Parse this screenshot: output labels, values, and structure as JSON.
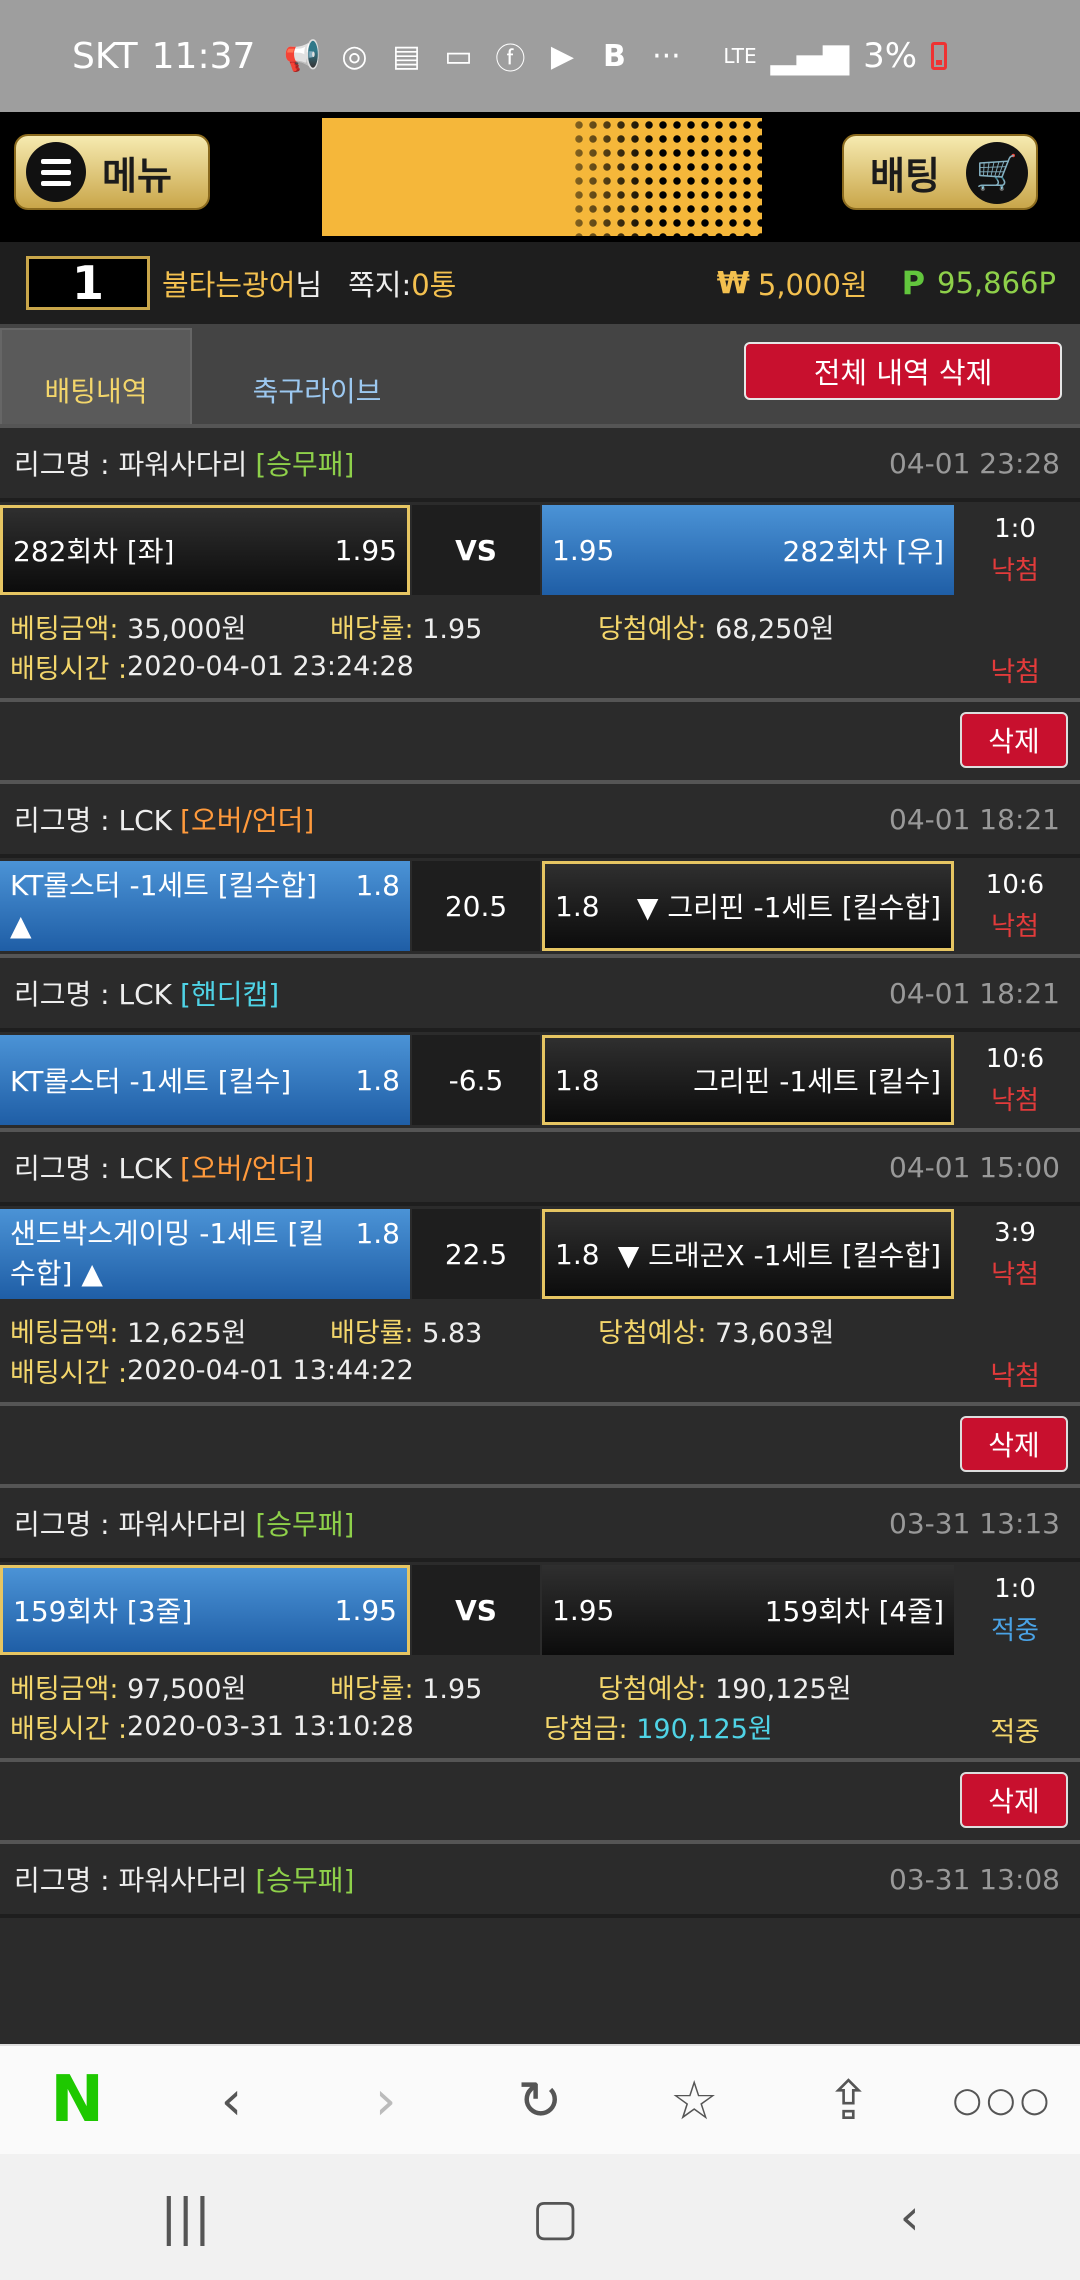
{
  "status": {
    "carrier": "SKT",
    "time": "11:37",
    "battery": "3%",
    "net": "LTE"
  },
  "header": {
    "menu_label": "메뉴",
    "bet_label": "배팅"
  },
  "user": {
    "level": "1",
    "name": "불타는광어",
    "suffix": "님",
    "message_label": "쪽지:",
    "message_count": "0통",
    "cash_icon": "₩",
    "cash": "5,000원",
    "points_icon": "P",
    "points": "95,866P"
  },
  "tabs": {
    "active": "배팅내역",
    "inactive": "축구라이브",
    "delete_all": "전체 내역 삭제"
  },
  "labels": {
    "league_prefix": "리그명 : ",
    "bet_amount": "베팅금액:",
    "odds": "배당률:",
    "expected": "당첨예상:",
    "bet_time": "배팅시간 : ",
    "win_amount": "당첨금:",
    "delete": "삭제"
  },
  "bets": [
    {
      "games": [
        {
          "league": "파워사다리",
          "type": "[승무패]",
          "date": "04-01 23:28",
          "left_name": "282회차 [좌]",
          "left_odds": "1.95",
          "mid": "VS",
          "right_odds": "1.95",
          "right_name": "282회차 [우]",
          "score": "1:0",
          "result": "낙첨"
        }
      ],
      "amount": "35,000원",
      "odds": "1.95",
      "expected": "68,250원",
      "time": "2020-04-01 23:24:28",
      "status": "낙첨"
    },
    {
      "games": [
        {
          "league": "LCK",
          "type": "[오버/언더]",
          "date": "04-01 18:21",
          "left_name": "KT롤스터 -1세트 [킬수합] ▲",
          "left_odds": "1.8",
          "mid": "20.5",
          "right_odds": "1.8",
          "right_name": "▼ 그리핀 -1세트 [킬수합]",
          "score": "10:6",
          "result": "낙첨"
        },
        {
          "league": "LCK",
          "type": "[핸디캡]",
          "date": "04-01 18:21",
          "left_name": "KT롤스터 -1세트 [킬수]",
          "left_odds": "1.8",
          "mid": "-6.5",
          "right_odds": "1.8",
          "right_name": "그리핀 -1세트 [킬수]",
          "score": "10:6",
          "result": "낙첨"
        },
        {
          "league": "LCK",
          "type": "[오버/언더]",
          "date": "04-01 15:00",
          "left_name": "샌드박스게이밍 -1세트 [킬수합] ▲",
          "left_odds": "1.8",
          "mid": "22.5",
          "right_odds": "1.8",
          "right_name": "▼ 드래곤X -1세트 [킬수합]",
          "score": "3:9",
          "result": "낙첨"
        }
      ],
      "amount": "12,625원",
      "odds": "5.83",
      "expected": "73,603원",
      "time": "2020-04-01 13:44:22",
      "status": "낙첨"
    },
    {
      "games": [
        {
          "league": "파워사다리",
          "type": "[승무패]",
          "date": "03-31 13:13",
          "left_name": "159회차 [3줄]",
          "left_odds": "1.95",
          "mid": "VS",
          "right_odds": "1.95",
          "right_name": "159회차 [4줄]",
          "score": "1:0",
          "result": "적중"
        }
      ],
      "amount": "97,500원",
      "odds": "1.95",
      "expected": "190,125원",
      "time": "2020-03-31 13:10:28",
      "win": "190,125원",
      "status": "적중"
    }
  ],
  "last_league": {
    "league": "파워사다리",
    "type": "[승무패]",
    "date": "03-31 13:08"
  },
  "browser_nav": [
    "naver-logo",
    "back-icon",
    "forward-icon",
    "refresh-icon",
    "bookmark-icon",
    "share-icon",
    "more-icon"
  ]
}
